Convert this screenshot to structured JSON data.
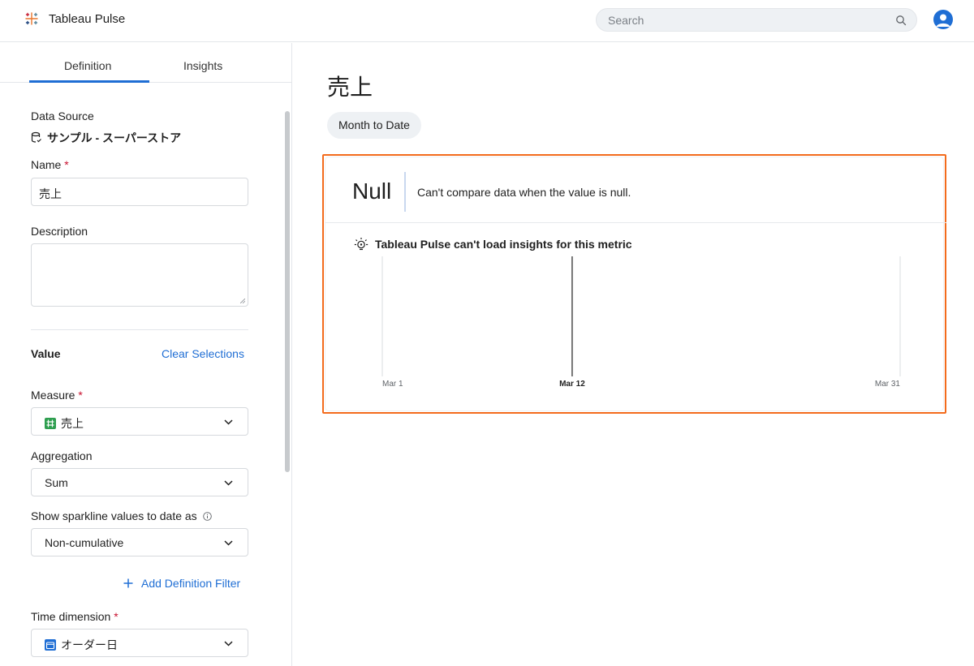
{
  "app": {
    "title": "Tableau Pulse"
  },
  "search": {
    "placeholder": "Search"
  },
  "tabs": [
    {
      "label": "Definition",
      "active": true
    },
    {
      "label": "Insights",
      "active": false
    }
  ],
  "definition": {
    "data_source_label": "Data Source",
    "data_source_value": "サンプル - スーパーストア",
    "name_label": "Name",
    "name_value": "売上",
    "description_label": "Description",
    "description_value": "",
    "value_section": "Value",
    "clear_selections": "Clear Selections",
    "measure_label": "Measure",
    "measure_value": "売上",
    "aggregation_label": "Aggregation",
    "aggregation_value": "Sum",
    "sparkline_label": "Show sparkline values to date as",
    "sparkline_value": "Non-cumulative",
    "add_filter": "Add Definition Filter",
    "time_dimension_label": "Time dimension",
    "time_dimension_value": "オーダー日",
    "required_mark": "*"
  },
  "main": {
    "title": "売上",
    "period_pill": "Month to Date",
    "card": {
      "value": "Null",
      "compare_text": "Can't compare data when the value is null.",
      "insight_message": "Tableau Pulse can't load insights for this metric"
    }
  },
  "chart_data": {
    "type": "line",
    "x_ticks": [
      "Mar 1",
      "Mar 12",
      "Mar 31"
    ],
    "highlighted_tick": "Mar 12",
    "series": [],
    "values": []
  },
  "colors": {
    "accent": "#1f6ed4",
    "highlight_border": "#f36b1c",
    "required": "#c8102e",
    "measure_icon": "#2e9e4f",
    "time_icon": "#1f6ed4"
  },
  "icons": {
    "logo": "tableau-logo-icon",
    "search": "search-icon",
    "avatar": "user-avatar-icon",
    "data_source": "database-icon",
    "info": "info-icon",
    "chevron": "chevron-down-icon",
    "plus": "plus-icon",
    "insight": "lightbulb-icon"
  }
}
